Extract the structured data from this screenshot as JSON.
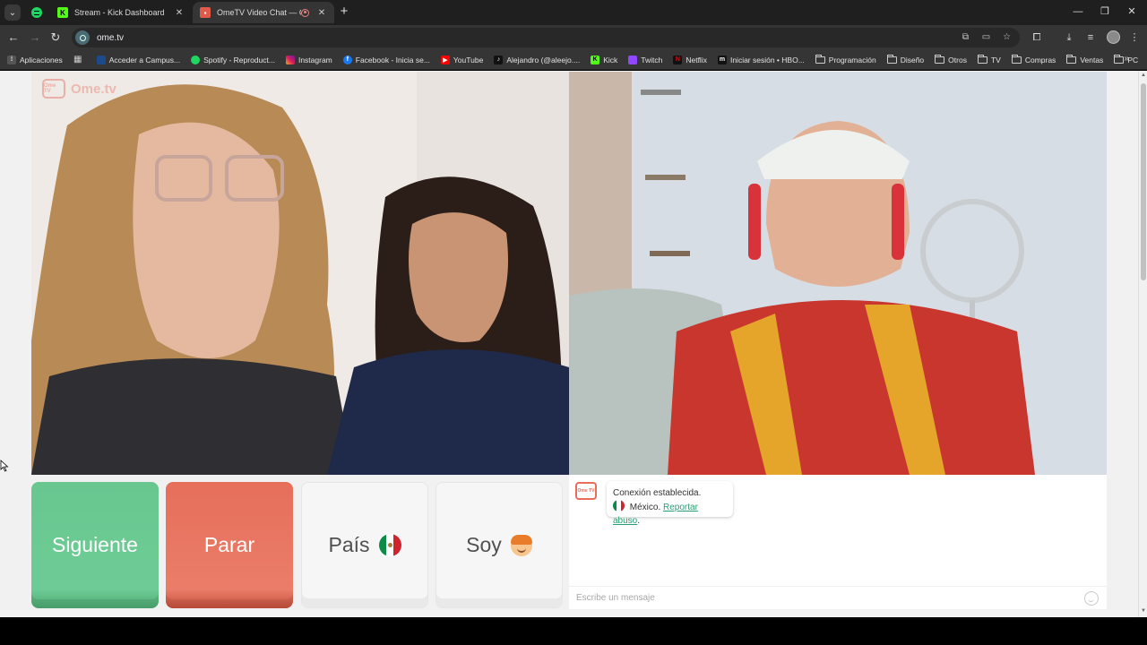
{
  "browser": {
    "tabs": [
      {
        "title": "Stream - Kick Dashboard",
        "icon": "kick-icon"
      },
      {
        "title": "OmeTV Video Chat — Ome",
        "icon": "ometv-icon"
      }
    ],
    "url": "ome.tv"
  },
  "bookmarks": [
    {
      "label": "Aplicaciones",
      "icon": "apps-grid-icon"
    },
    {
      "label": "Acceder a Campus...",
      "icon": "campus-icon"
    },
    {
      "label": "Spotify - Reproduct...",
      "icon": "spotify-icon"
    },
    {
      "label": "Instagram",
      "icon": "instagram-icon"
    },
    {
      "label": "Facebook - Inicia se...",
      "icon": "facebook-icon"
    },
    {
      "label": "YouTube",
      "icon": "youtube-icon"
    },
    {
      "label": "Alejandro (@aleejo....",
      "icon": "tiktok-icon"
    },
    {
      "label": "Kick",
      "icon": "kick-icon"
    },
    {
      "label": "Twitch",
      "icon": "twitch-icon"
    },
    {
      "label": "Netflix",
      "icon": "netflix-icon"
    },
    {
      "label": "Iniciar sesión • HBO...",
      "icon": "hbo-icon"
    },
    {
      "label": "Programación",
      "icon": "folder-icon"
    },
    {
      "label": "Diseño",
      "icon": "folder-icon"
    },
    {
      "label": "Otros",
      "icon": "folder-icon"
    },
    {
      "label": "TV",
      "icon": "folder-icon"
    },
    {
      "label": "Compras",
      "icon": "folder-icon"
    },
    {
      "label": "Ventas",
      "icon": "folder-icon"
    },
    {
      "label": "PC",
      "icon": "folder-icon"
    }
  ],
  "app": {
    "logo_text": "Ome.tv",
    "logo_badge": "Ome TV"
  },
  "controls": {
    "next_label": "Siguiente",
    "stop_label": "Parar",
    "country_label": "País",
    "gender_label": "Soy"
  },
  "chat": {
    "system_message": "Conexión establecida.",
    "country": "México.",
    "report_link": "Reportar abuso",
    "report_suffix": ".",
    "input_placeholder": "Escribe un mensaje"
  },
  "colors": {
    "next": "#6fcb95",
    "stop": "#ea7d69",
    "link": "#2a9d73"
  }
}
